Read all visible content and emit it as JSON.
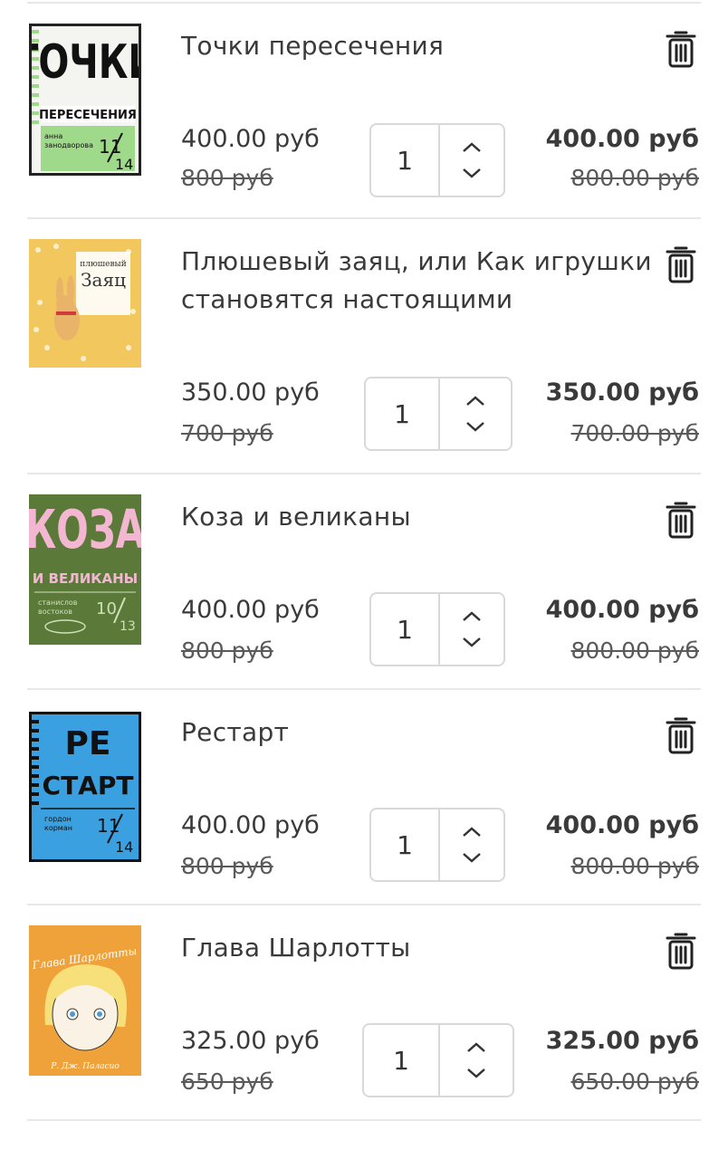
{
  "items": [
    {
      "title": "Точки пересечения",
      "price": "400.00 руб",
      "old_price": "800 руб",
      "qty": "1",
      "total": "400.00 руб",
      "total_old": "800.00 руб",
      "cover": {
        "bg": "#9fd98a",
        "main": "ТОЧКИ",
        "sub": "ПЕРЕСЕЧЕНИЯ",
        "author": "анна\nзанодворова",
        "num": "11/14"
      }
    },
    {
      "title": "Плюшевый заяц, или Как игрушки становятся настоящими",
      "price": "350.00 руб",
      "old_price": "700 руб",
      "qty": "1",
      "total": "350.00 руб",
      "total_old": "700.00 руб",
      "cover": {
        "bg": "#f1c75e",
        "main": "Заяц",
        "sub": "плюшевый"
      }
    },
    {
      "title": "Коза и великаны",
      "price": "400.00 руб",
      "old_price": "800 руб",
      "qty": "1",
      "total": "400.00 руб",
      "total_old": "800.00 руб",
      "cover": {
        "bg": "#5b7a3a",
        "main": "КОЗА",
        "sub": "И ВЕЛИКАНЫ",
        "author": "станислов\nвостоков",
        "num": "10/13"
      }
    },
    {
      "title": "Рестарт",
      "price": "400.00 руб",
      "old_price": "800 руб",
      "qty": "1",
      "total": "400.00 руб",
      "total_old": "800.00 руб",
      "cover": {
        "bg": "#3aa0df",
        "main": "РЕ",
        "sub": "СТАРТ",
        "author": "гордон\nкорман",
        "num": "11/14"
      }
    },
    {
      "title": "Глава Шарлотты",
      "price": "325.00 руб",
      "old_price": "650 руб",
      "qty": "1",
      "total": "325.00 руб",
      "total_old": "650.00 руб",
      "cover": {
        "bg": "#f0a23a",
        "main": "Глава Шарлотты",
        "sub": "Р. Дж. Паласио"
      }
    }
  ],
  "icons": {
    "delete": "trash-icon",
    "increase": "chevron-up-icon",
    "decrease": "chevron-down-icon"
  }
}
